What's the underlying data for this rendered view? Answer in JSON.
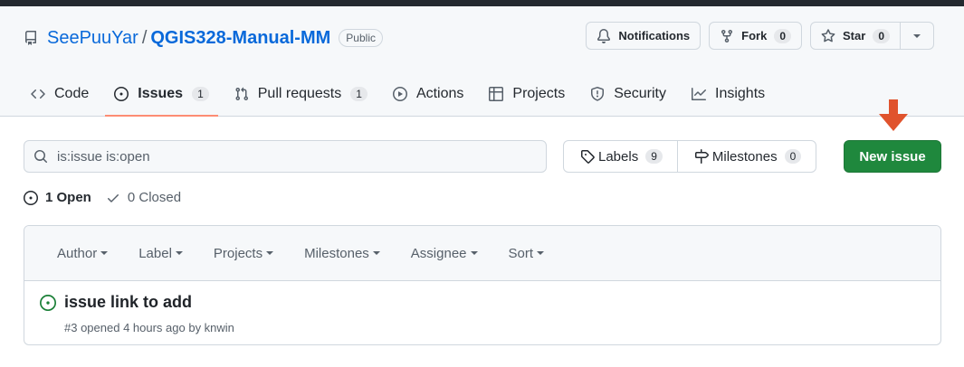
{
  "repo": {
    "owner": "SeePuuYar",
    "separator": "/",
    "name": "QGIS328-Manual-MM",
    "visibility": "Public"
  },
  "actions": {
    "notifications_label": "Notifications",
    "fork_label": "Fork",
    "fork_count": "0",
    "star_label": "Star",
    "star_count": "0"
  },
  "tabs": [
    {
      "label": "Code",
      "icon": "code-icon"
    },
    {
      "label": "Issues",
      "icon": "issue-opened-icon",
      "count": "1",
      "selected": true
    },
    {
      "label": "Pull requests",
      "icon": "git-pull-request-icon",
      "count": "1"
    },
    {
      "label": "Actions",
      "icon": "play-icon"
    },
    {
      "label": "Projects",
      "icon": "table-icon"
    },
    {
      "label": "Security",
      "icon": "shield-icon"
    },
    {
      "label": "Insights",
      "icon": "graph-icon"
    }
  ],
  "search": {
    "value": "is:issue is:open"
  },
  "labels": {
    "label": "Labels",
    "count": "9"
  },
  "milestones": {
    "label": "Milestones",
    "count": "0"
  },
  "new_issue_label": "New issue",
  "states": {
    "open_label": "1 Open",
    "closed_label": "0 Closed"
  },
  "filters": [
    "Author",
    "Label",
    "Projects",
    "Milestones",
    "Assignee",
    "Sort"
  ],
  "issues": [
    {
      "title": "issue link to add",
      "meta": "#3 opened 4 hours ago by knwin"
    }
  ],
  "colors": {
    "link": "#0969da",
    "primary_button": "#1f883d",
    "open_icon": "#1a7f37",
    "annotation_arrow": "#e0532d",
    "selected_tab_underline": "#fd8c73"
  }
}
